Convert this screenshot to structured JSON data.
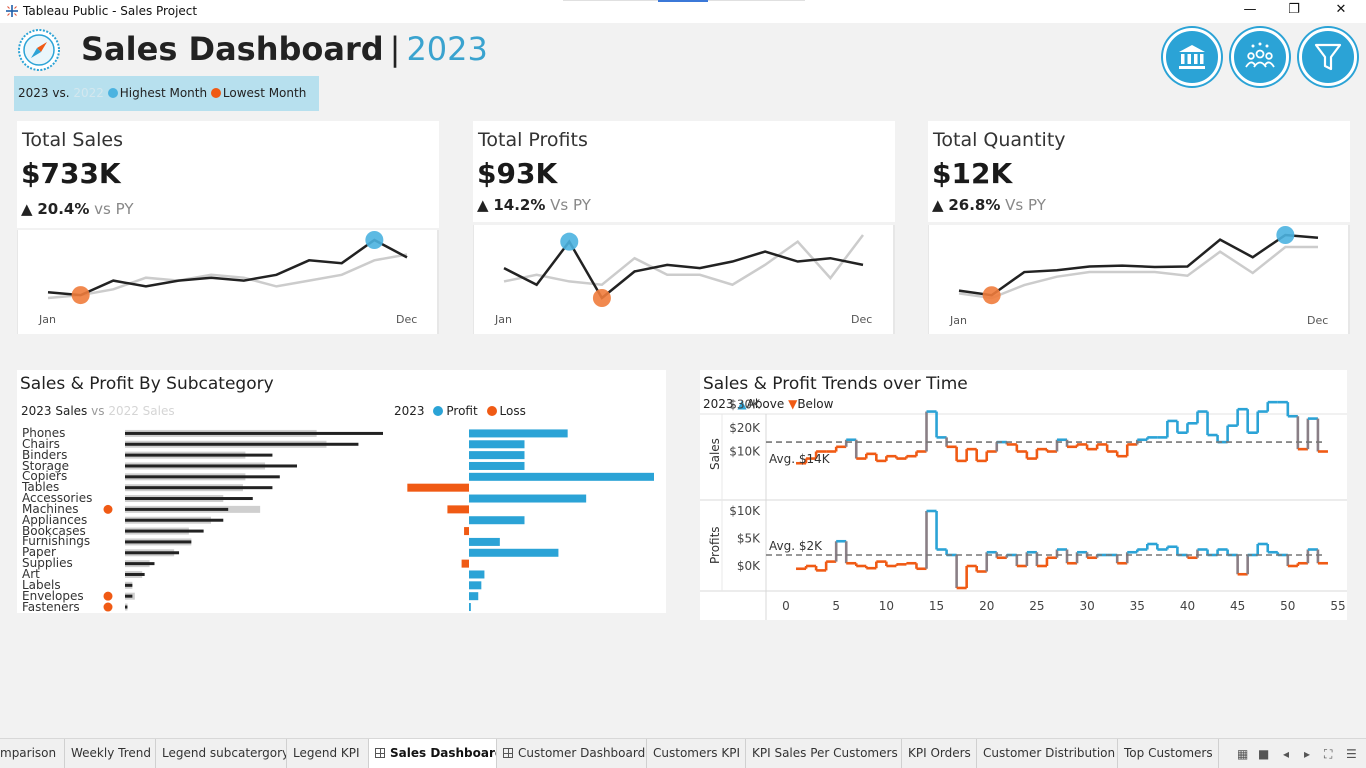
{
  "window": {
    "title": "Tableau Public - Sales Project"
  },
  "header": {
    "title": "Sales Dashboard",
    "separator": "|",
    "year": "2023",
    "legend": {
      "current": "2023 vs.",
      "previous": "2022",
      "highest": "Highest Month",
      "lowest": "Lowest Month"
    }
  },
  "nav_buttons": [
    "bank-icon",
    "customers-icon",
    "filter-icon"
  ],
  "colors": {
    "accent": "#2ba3d6",
    "negative": "#f05a14",
    "highest": "#4bb3e0",
    "lowest": "#f07c3c",
    "current_line": "#222222",
    "prior_line": "#cccccc"
  },
  "kpis": [
    {
      "name": "Total Sales",
      "value": "$733K",
      "arrow": "▲",
      "pct": "20.4%",
      "vs": "vs PY",
      "x_start": "Jan",
      "x_end": "Dec",
      "current": [
        20,
        19,
        24,
        22,
        24,
        25,
        24,
        26,
        31,
        30,
        38,
        32
      ],
      "prior": [
        18,
        19,
        21,
        25,
        24,
        26,
        25,
        22,
        24,
        26,
        31,
        33
      ],
      "high_index": 10,
      "low_index": 1
    },
    {
      "name": "Total Profits",
      "value": "$93K",
      "arrow": "▲",
      "pct": "14.2%",
      "vs": "Vs PY",
      "x_start": "Jan",
      "x_end": "Dec",
      "current": [
        7.5,
        5.0,
        11.5,
        3.0,
        7.0,
        8.0,
        7.5,
        8.5,
        10.0,
        8.5,
        9.0,
        8.0
      ],
      "prior": [
        5.5,
        6.5,
        5.5,
        5.0,
        9.0,
        6.5,
        6.5,
        5.0,
        8.0,
        11.5,
        6.0,
        12.5
      ],
      "high_index": 2,
      "low_index": 3
    },
    {
      "name": "Total Quantity",
      "value": "$12K",
      "arrow": "▲",
      "pct": "26.8%",
      "vs": "Vs PY",
      "x_start": "Jan",
      "x_end": "Dec",
      "current": [
        500,
        450,
        700,
        720,
        760,
        770,
        755,
        760,
        1050,
        860,
        1100,
        1070
      ],
      "prior": [
        470,
        420,
        560,
        650,
        700,
        700,
        700,
        660,
        920,
        690,
        970,
        970
      ],
      "high_index": 10,
      "low_index": 1
    }
  ],
  "subcategory": {
    "title": "Sales & Profit By Subcategory",
    "legend_left": {
      "current": "2023 Sales",
      "vs": "vs",
      "previous": "2022 Sales"
    },
    "legend_right": {
      "year": "2023",
      "profit": "Profit",
      "loss": "Loss"
    },
    "chart_data": {
      "type": "bar",
      "categories": [
        "Phones",
        "Chairs",
        "Binders",
        "Storage",
        "Copiers",
        "Tables",
        "Accessories",
        "Machines",
        "Appliances",
        "Bookcases",
        "Furnishings",
        "Paper",
        "Supplies",
        "Art",
        "Labels",
        "Envelopes",
        "Fasteners"
      ],
      "series": [
        {
          "name": "2023 Sales",
          "values": [
            105,
            95,
            60,
            70,
            63,
            60,
            52,
            42,
            40,
            32,
            27,
            22,
            12,
            8,
            3,
            3,
            1
          ]
        },
        {
          "name": "2022 Sales",
          "values": [
            78,
            82,
            49,
            57,
            49,
            48,
            40,
            55,
            35,
            26,
            27,
            20,
            10,
            7,
            3,
            4,
            1
          ]
        },
        {
          "name": "Profit",
          "values": [
            16,
            9,
            9,
            9,
            30,
            -10,
            19,
            -3.5,
            9,
            -0.8,
            5,
            14.5,
            -1.2,
            2.5,
            2,
            1.5,
            0.3
          ]
        }
      ],
      "loss_markers": [
        "Machines",
        "Envelopes",
        "Fasteners"
      ]
    }
  },
  "trends": {
    "title": "Sales & Profit Trends over Time",
    "legend": {
      "year": "2023",
      "above": "Above",
      "below": "Below"
    },
    "sales_label": "Sales",
    "profits_label": "Profits",
    "sales_ticks": [
      "$30K",
      "$20K",
      "$10K"
    ],
    "profit_ticks": [
      "$10K",
      "$5K",
      "$0K"
    ],
    "sales_avg_label": "Avg. $14K",
    "profit_avg_label": "Avg. $2K",
    "x_ticks": [
      "0",
      "5",
      "10",
      "15",
      "20",
      "25",
      "30",
      "35",
      "40",
      "45",
      "50",
      "55"
    ],
    "chart_data": {
      "type": "line",
      "x_label": "",
      "x": [
        1,
        2,
        3,
        4,
        5,
        6,
        7,
        8,
        9,
        10,
        11,
        12,
        13,
        14,
        15,
        16,
        17,
        18,
        19,
        20,
        21,
        22,
        23,
        24,
        25,
        26,
        27,
        28,
        29,
        30,
        31,
        32,
        33,
        34,
        35,
        36,
        37,
        38,
        39,
        40,
        41,
        42,
        43,
        44,
        45,
        46,
        47,
        48,
        49,
        50,
        51,
        52,
        53
      ],
      "series": [
        {
          "name": "Sales",
          "avg": 14,
          "values": [
            5,
            7,
            10,
            10,
            12,
            15,
            7,
            9,
            6,
            8,
            7,
            8,
            10,
            27,
            16,
            12,
            6,
            11,
            6,
            10,
            14,
            13,
            10,
            7,
            11,
            10,
            15,
            12,
            13,
            11,
            13,
            10,
            8,
            13,
            15,
            16,
            16,
            23,
            18,
            22,
            27,
            17,
            14,
            21,
            28,
            18,
            27,
            31,
            31,
            25,
            11,
            24,
            10
          ]
        },
        {
          "name": "Profits",
          "avg": 2,
          "values": [
            -0.5,
            0,
            -0.8,
            0.8,
            4.5,
            0.5,
            0,
            -0.4,
            0.8,
            0,
            0.3,
            0.5,
            -0.5,
            10,
            3,
            2,
            -4,
            0,
            -1,
            2.5,
            1.5,
            2,
            0,
            2.5,
            0,
            1.5,
            3,
            0.5,
            2.5,
            1.5,
            2,
            2,
            0.5,
            2.5,
            3,
            4,
            3,
            3.5,
            2,
            1.5,
            3,
            2,
            3,
            2,
            -1.5,
            2,
            4,
            2.5,
            2,
            0,
            0.5,
            3,
            0.5
          ]
        }
      ]
    }
  },
  "tabs": [
    {
      "label": "mparison",
      "icon": false,
      "active": false
    },
    {
      "label": "Weekly Trend",
      "icon": false,
      "active": false
    },
    {
      "label": "Legend subcatergory",
      "icon": false,
      "active": false
    },
    {
      "label": "Legend KPI",
      "icon": false,
      "active": false
    },
    {
      "label": "Sales Dashboard",
      "icon": true,
      "active": true
    },
    {
      "label": "Customer Dashboard",
      "icon": true,
      "active": false
    },
    {
      "label": "Customers KPI",
      "icon": false,
      "active": false
    },
    {
      "label": "KPI Sales Per Customers",
      "icon": false,
      "active": false
    },
    {
      "label": "KPI Orders",
      "icon": false,
      "active": false
    },
    {
      "label": "Customer Distribution",
      "icon": false,
      "active": false
    },
    {
      "label": "Top Customers",
      "icon": false,
      "active": false
    }
  ]
}
